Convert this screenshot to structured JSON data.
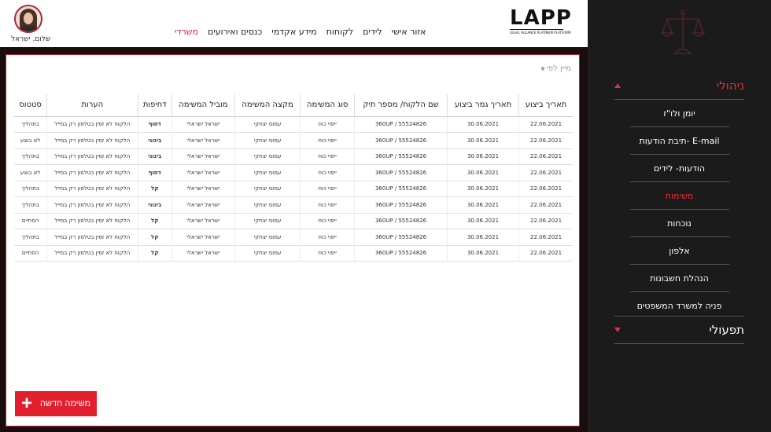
{
  "header": {
    "greeting": "שלום, ישראל",
    "logo_letters": "LAPP",
    "logo_tagline": "LEGAL ALLIANCE PLATINUM PLATFORM",
    "nav": [
      {
        "label": "משרדי",
        "active": true
      },
      {
        "label": "כנסים ואירועים",
        "active": false
      },
      {
        "label": "מידע אקדמי",
        "active": false
      },
      {
        "label": "לקוחות",
        "active": false
      },
      {
        "label": "לידים",
        "active": false
      },
      {
        "label": "אזור אישי",
        "active": false
      }
    ]
  },
  "sidebar": {
    "section_admin": "ניהולי",
    "section_ops": "תפעולי",
    "items": [
      {
        "label": "יומן ולו\"ז",
        "active": false
      },
      {
        "label": "E-mail -תיבת הודעות",
        "active": false
      },
      {
        "label": "הודעות- לידים",
        "active": false
      },
      {
        "label": "משימות",
        "active": true
      },
      {
        "label": "נוכחות",
        "active": false
      },
      {
        "label": "אלפון",
        "active": false
      },
      {
        "label": "הנהלת חשבונות",
        "active": false
      },
      {
        "label": "פניה למשרד המשפטים",
        "active": false
      }
    ]
  },
  "main": {
    "sort_label": "מיין לפי",
    "columns": [
      "תאריך ביצוע",
      "תאריך גמר ביצוע",
      "שם הלקוח/ מספר תיק",
      "סוג המשימה",
      "מקצה המשימה",
      "מוביל המשימה",
      "דחיפות",
      "הערות",
      "סטטוס"
    ],
    "rows": [
      {
        "date": "22.06.2021",
        "end": "30.06.2021",
        "client": "360UP / 55524826",
        "type": "ייפוי כוח",
        "assigner": "עמוס יצחקי",
        "lead": "ישראל ישראלי",
        "priority": "דחוף",
        "priority_level": "urgent",
        "notes": "הלקוח לא זמין בטלפון רק במייל",
        "status": "בתהליך"
      },
      {
        "date": "22.06.2021",
        "end": "30.06.2021",
        "client": "360UP / 55524826",
        "type": "ייפוי כוח",
        "assigner": "עמוס יצחקי",
        "lead": "ישראל ישראלי",
        "priority": "בינוני",
        "priority_level": "medium",
        "notes": "הלקוח לא זמין בטלפון רק במייל",
        "status": "לא בוצע"
      },
      {
        "date": "22.06.2021",
        "end": "30.06.2021",
        "client": "360UP / 55524826",
        "type": "ייפוי כוח",
        "assigner": "עמוס יצחקי",
        "lead": "ישראל ישראלי",
        "priority": "בינוני",
        "priority_level": "medium",
        "notes": "הלקוח לא זמין בטלפון רק במייל",
        "status": "בתהליך"
      },
      {
        "date": "22.06.2021",
        "end": "30.06.2021",
        "client": "360UP / 55524826",
        "type": "ייפוי כוח",
        "assigner": "עמוס יצחקי",
        "lead": "ישראל ישראלי",
        "priority": "דחוף",
        "priority_level": "urgent",
        "notes": "הלקוח לא זמין בטלפון רק במייל",
        "status": "לא בוצע"
      },
      {
        "date": "22.06.2021",
        "end": "30.06.2021",
        "client": "360UP / 55524826",
        "type": "ייפוי כוח",
        "assigner": "עמוס יצחקי",
        "lead": "ישראל ישראלי",
        "priority": "קל",
        "priority_level": "low",
        "notes": "הלקוח לא זמין בטלפון רק במייל",
        "status": "בתהליך"
      },
      {
        "date": "22.06.2021",
        "end": "30.06.2021",
        "client": "360UP / 55524826",
        "type": "ייפוי כוח",
        "assigner": "עמוס יצחקי",
        "lead": "ישראל ישראלי",
        "priority": "בינוני",
        "priority_level": "medium",
        "notes": "הלקוח לא זמין בטלפון רק במייל",
        "status": "בתהליך"
      },
      {
        "date": "22.06.2021",
        "end": "30.06.2021",
        "client": "360UP / 55524826",
        "type": "ייפוי כוח",
        "assigner": "עמוס יצחקי",
        "lead": "ישראל ישראלי",
        "priority": "קל",
        "priority_level": "low",
        "notes": "הלקוח לא זמין בטלפון רק במייל",
        "status": "הסתיים"
      },
      {
        "date": "22.06.2021",
        "end": "30.06.2021",
        "client": "360UP / 55524826",
        "type": "ייפוי כוח",
        "assigner": "עמוס יצחקי",
        "lead": "ישראל ישראלי",
        "priority": "קל",
        "priority_level": "low",
        "notes": "הלקוח לא זמין בטלפון רק במייל",
        "status": "בתהליך"
      },
      {
        "date": "22.06.2021",
        "end": "30.06.2021",
        "client": "360UP / 55524826",
        "type": "ייפוי כוח",
        "assigner": "עמוס יצחקי",
        "lead": "ישראל ישראלי",
        "priority": "קל",
        "priority_level": "low",
        "notes": "הלקוח לא זמין בטלפון רק במייל",
        "status": "הסתיים"
      }
    ],
    "add_button_label": "משימה חדשה"
  },
  "colors": {
    "accent": "#e21f2d",
    "sidebar_bg": "#1b1b1b",
    "urgent": "#d21f2f",
    "medium": "#e0a000",
    "low": "#2e9a3a"
  }
}
